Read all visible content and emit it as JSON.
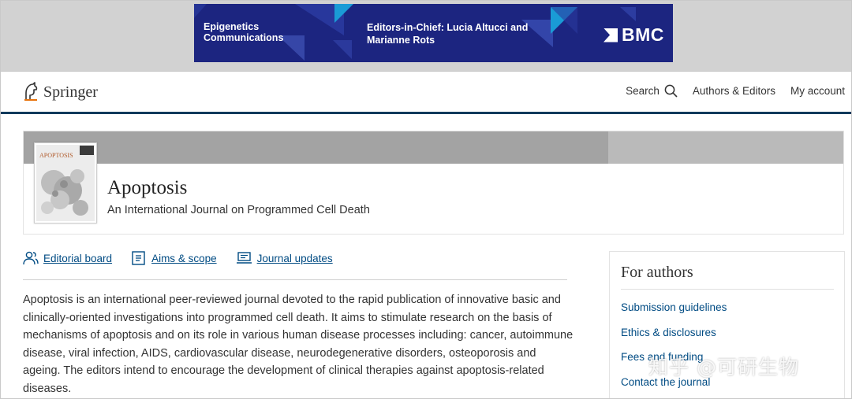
{
  "ad": {
    "left_text": "Epigenetics\nCommunications",
    "mid_text": "Editors-in-Chief: Lucia Altucci and\nMarianne Rots",
    "logo_text": "BMC"
  },
  "header": {
    "brand": "Springer",
    "nav": {
      "search": "Search",
      "authors_editors": "Authors & Editors",
      "my_account": "My account"
    }
  },
  "journal": {
    "title": "Apoptosis",
    "subtitle": "An International Journal on Programmed Cell Death",
    "cover_title": "APOPTOSIS"
  },
  "links": {
    "editorial_board": "Editorial board",
    "aims_scope": "Aims & scope",
    "journal_updates": "Journal updates"
  },
  "description": "Apoptosis is an international peer-reviewed journal devoted to the rapid publication of innovative basic and clinically-oriented investigations into programmed cell death. It aims to stimulate research on the basis of mechanisms of apoptosis and on its role in various human disease processes including: cancer, autoimmune disease, viral infection, AIDS, cardiovascular disease, neurodegenerative disorders, osteoporosis and ageing. The editors intend to encourage the development of clinical therapies against apoptosis-related diseases.",
  "for_authors": {
    "title": "For authors",
    "items": [
      "Submission guidelines",
      "Ethics & disclosures",
      "Fees and funding",
      "Contact the journal"
    ]
  },
  "watermark": "知乎 @可研生物",
  "colors": {
    "ad_bg": "#1c2580",
    "header_rule": "#0f3a5c",
    "link": "#004b83"
  }
}
